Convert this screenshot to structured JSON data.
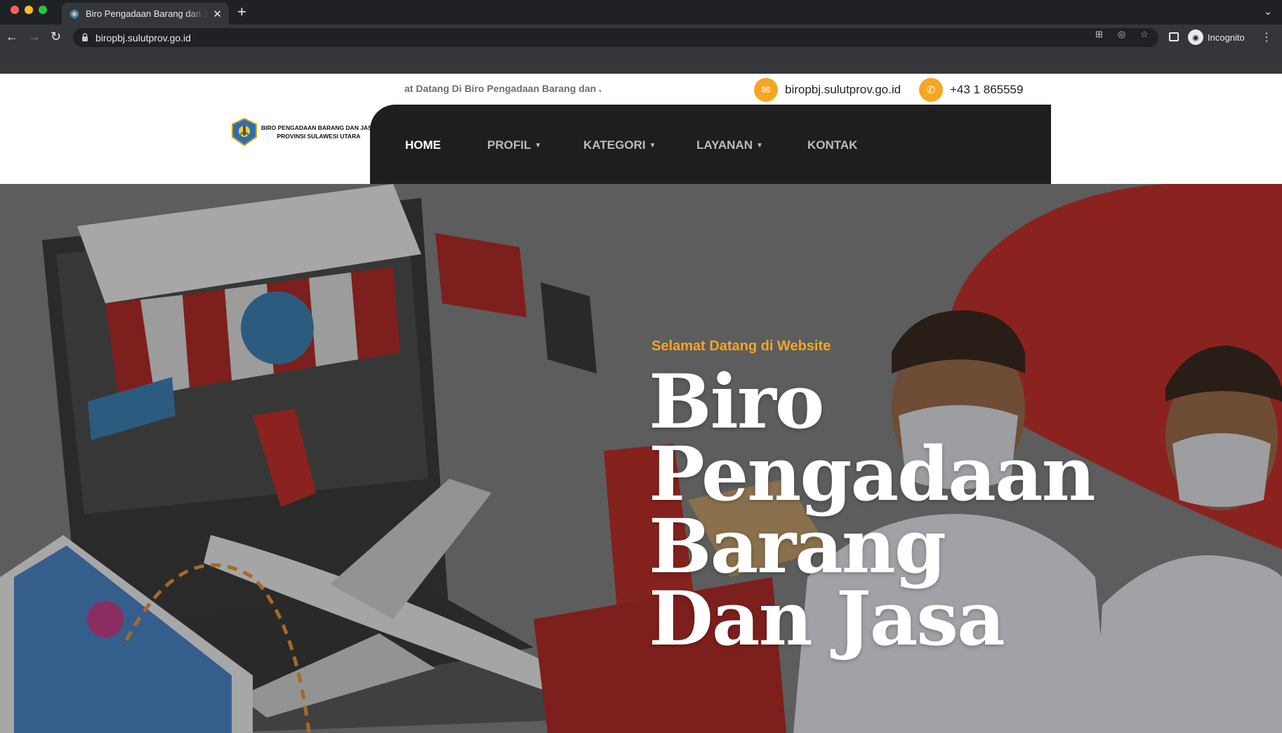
{
  "browser": {
    "tab_title": "Biro Pengadaan Barang dan Jasa",
    "url": "biropbj.sulutprov.go.id",
    "profile_label": "Incognito",
    "icons": [
      "back-arrow-icon",
      "forward-arrow-icon",
      "reload-icon",
      "lock-icon",
      "translate-icon",
      "eye-off-icon",
      "star-icon",
      "side-panel-icon",
      "incognito-icon",
      "more-menu-icon"
    ]
  },
  "topbar": {
    "marquee": "at Datang Di Biro Pengadaan Barang dan Jasa",
    "email": "biropbj.sulutprov.go.id",
    "phone": "+43 1 865559"
  },
  "logo": {
    "line1": "BIRO PENGADAAN BARANG DAN JASA",
    "line2": "PROVINSI SULAWESI UTARA"
  },
  "nav": {
    "home": "HOME",
    "profil": "PROFIL",
    "kategori": "KATEGORI",
    "layanan": "LAYANAN",
    "kontak": "KONTAK"
  },
  "hero": {
    "subtitle": "Selamat Datang di Website",
    "title": "Biro Pengadaan Barang Dan Jasa"
  },
  "colors": {
    "accent": "#f5a623",
    "nav_bg": "#1e1e1e",
    "hero_red": "#b0221c"
  }
}
